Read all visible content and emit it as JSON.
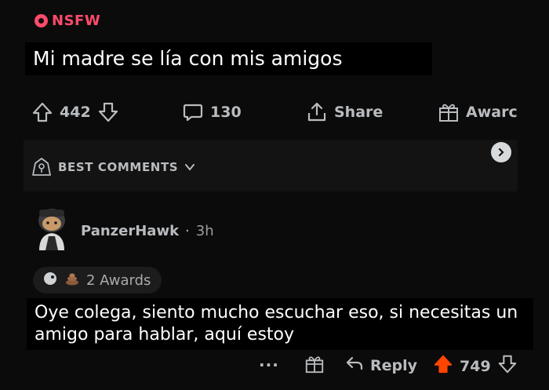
{
  "post": {
    "nsfw_label": "NSFW",
    "title_caption": "Mi madre se lía con mis amigos",
    "upvotes": "442",
    "comments": "130",
    "share_label": "Share",
    "award_label": "Awarc"
  },
  "sort": {
    "label": "BEST COMMENTS"
  },
  "comment": {
    "author": "PanzerHawk",
    "separator": "·",
    "time": "3h",
    "awards_label": "2 Awards",
    "caption": "Oye colega, siento mucho escuchar eso, si necesitas un amigo para hablar, aquí estoy",
    "more_label": "···",
    "reply_label": "Reply",
    "votes": "749"
  },
  "colors": {
    "background": "#0b0b0b",
    "nsfw": "#ff4a6b",
    "upvote_active": "#ff4500",
    "text": "#b9bcbf"
  },
  "icons": [
    "nsfw-icon",
    "upvote-icon",
    "downvote-icon",
    "comment-icon",
    "share-icon",
    "gift-icon",
    "shield-icon",
    "chevron-down-icon",
    "chevron-right-icon",
    "avatar",
    "award-silver-icon",
    "award-poop-icon",
    "reply-icon"
  ]
}
